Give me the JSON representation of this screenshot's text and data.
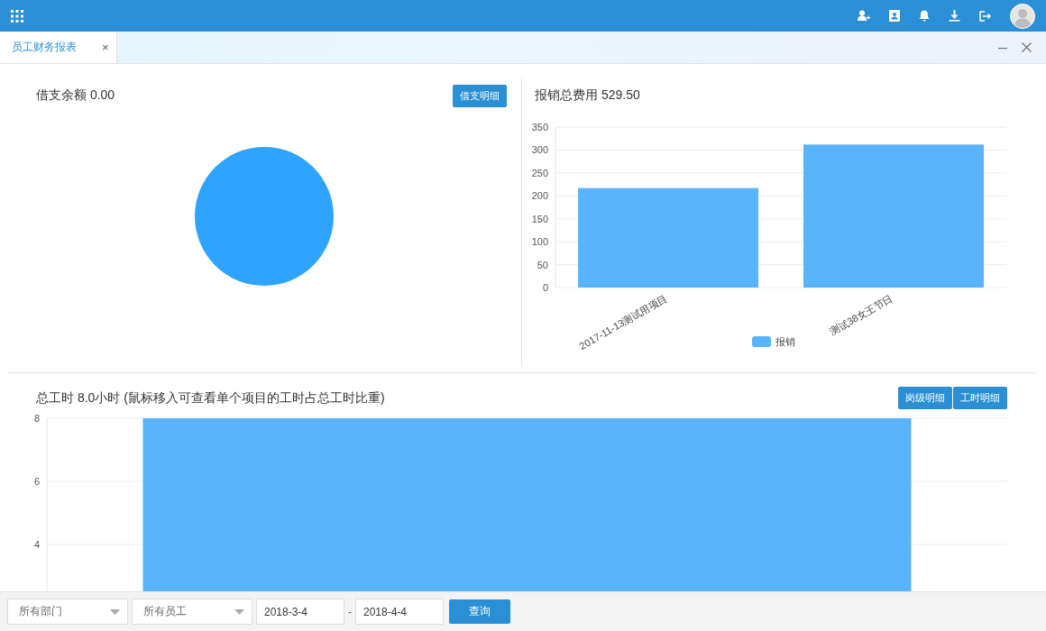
{
  "tabs": [
    {
      "label": "员工财务报表",
      "selected": true,
      "close": "×"
    }
  ],
  "loan_panel": {
    "title": "借支余额 0.00",
    "button": "借支明细"
  },
  "expense_panel": {
    "title": "报销总费用 529.50",
    "chart_data": {
      "type": "bar",
      "categories": [
        "2017-11-13测试用项目",
        "测试38女王节日"
      ],
      "series": [
        {
          "name": "报销",
          "color": "#5ab4fc",
          "values": [
            217,
            312
          ]
        }
      ],
      "ylim": [
        0,
        350
      ],
      "yticks": [
        0,
        50,
        100,
        150,
        200,
        250,
        300,
        350
      ],
      "grid": true
    }
  },
  "hours_panel": {
    "title": "总工时 8.0小时 (鼠标移入可查看单个项目的工时占总工时比重)",
    "buttons": [
      "岗级明细",
      "工时明细"
    ],
    "chart_data": {
      "type": "bar",
      "values": [
        8
      ],
      "ylim": [
        0,
        8
      ],
      "yticks": [
        4,
        6,
        8
      ],
      "grid": true
    }
  },
  "filters": {
    "department": "所有部门",
    "employee": "所有员工",
    "date_from": "2018-3-4",
    "separator": "-",
    "date_to": "2018-4-4",
    "query_button": "查询"
  }
}
